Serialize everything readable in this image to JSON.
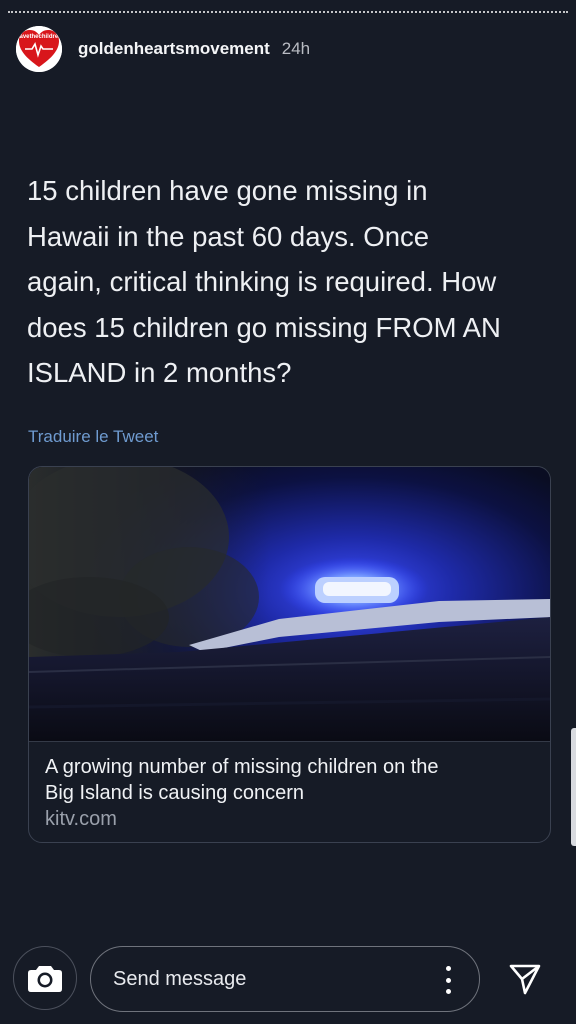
{
  "story": {
    "username": "goldenheartsmovement",
    "time_ago": "24h",
    "avatar_text": "savethechildren"
  },
  "tweet": {
    "text_lines": [
      "15 children have gone missing in",
      "Hawaii in the past 60 days. Once",
      "again, critical thinking is required. How",
      "does 15 children go missing FROM AN",
      "ISLAND in 2 months?"
    ],
    "translate_label": "Traduire le Tweet"
  },
  "link_card": {
    "title_line1": "A growing number of missing children on the",
    "title_line2": "Big Island is causing concern",
    "domain": "kitv.com"
  },
  "reply_bar": {
    "placeholder": "Send message"
  },
  "icons": {
    "camera": "camera-icon",
    "more": "more-vertical-icon",
    "send": "send-icon",
    "avatar": "heart-logo-icon"
  }
}
